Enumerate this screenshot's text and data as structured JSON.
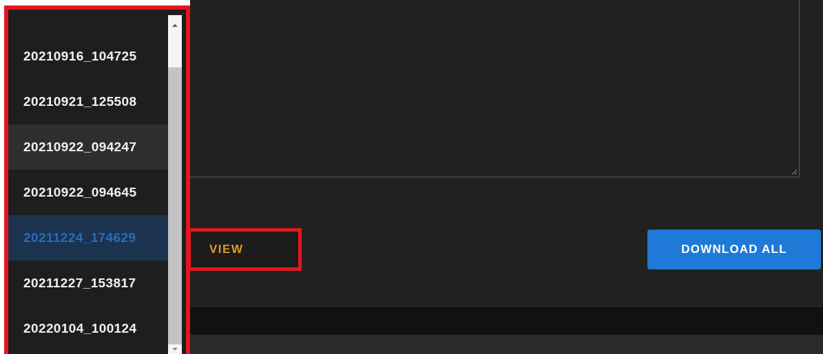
{
  "list": {
    "items": [
      {
        "label": "20210916_104725",
        "selected": false,
        "highlighted": false
      },
      {
        "label": "20210921_125508",
        "selected": false,
        "highlighted": false
      },
      {
        "label": "20210922_094247",
        "selected": false,
        "highlighted": true
      },
      {
        "label": "20210922_094645",
        "selected": false,
        "highlighted": false
      },
      {
        "label": "20211224_174629",
        "selected": true,
        "highlighted": false
      },
      {
        "label": "20211227_153817",
        "selected": false,
        "highlighted": false
      },
      {
        "label": "20220104_100124",
        "selected": false,
        "highlighted": false
      }
    ]
  },
  "buttons": {
    "view": "VIEW",
    "download_all": "DOWNLOAD ALL"
  }
}
